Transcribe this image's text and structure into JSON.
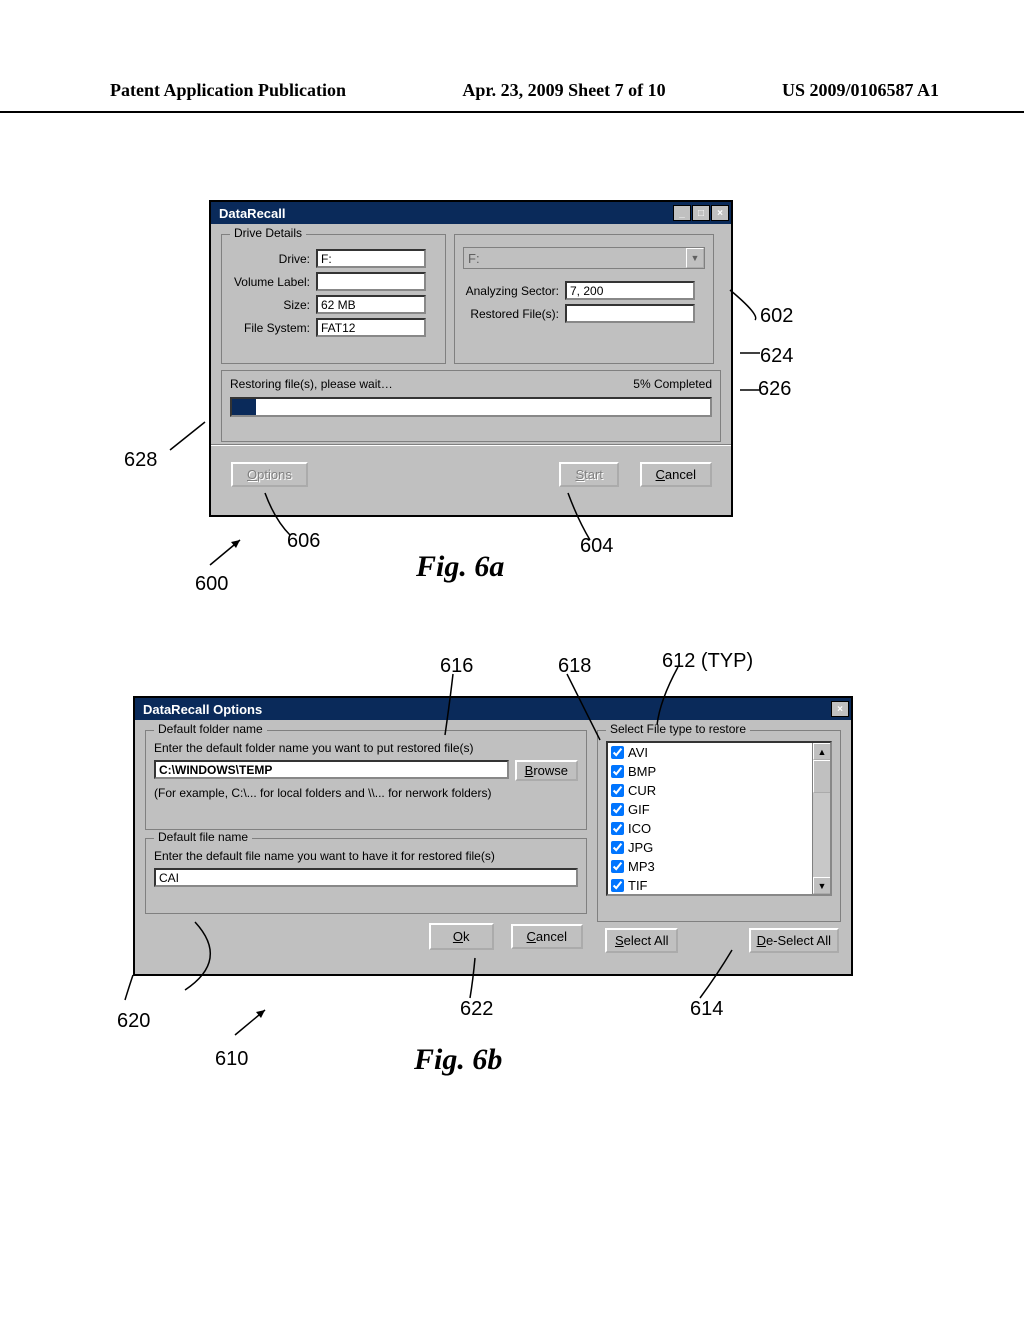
{
  "header": {
    "left": "Patent Application Publication",
    "mid": "Apr. 23, 2009  Sheet 7 of 10",
    "right": "US 2009/0106587 A1"
  },
  "win1": {
    "title": "DataRecall",
    "group_drive": "Drive Details",
    "lbl_drive": "Drive:",
    "val_drive": "F:",
    "lbl_vol": "Volume Label:",
    "val_vol": "",
    "lbl_size": "Size:",
    "val_size": "62 MB",
    "lbl_fs": "File System:",
    "val_fs": "FAT12",
    "dropdown_sel": "F:",
    "lbl_analyzing": "Analyzing Sector:",
    "val_analyzing": "7, 200",
    "lbl_restored": "Restored File(s):",
    "val_restored": "",
    "restoring_msg": "Restoring file(s), please wait…",
    "pct": "5% Completed",
    "progress_pct": 5,
    "btn_options": "Options",
    "btn_options_ul": "O",
    "btn_start": "Start",
    "btn_start_ul": "S",
    "btn_cancel": "Cancel",
    "btn_cancel_ul": "C"
  },
  "callouts1": {
    "c602": "602",
    "c624": "624",
    "c626": "626",
    "c628": "628",
    "c606": "606",
    "c604": "604",
    "c600": "600"
  },
  "caption1": "Fig. 6a",
  "win2": {
    "title": "DataRecall Options",
    "group_folder": "Default folder name",
    "folder_prompt": "Enter the default folder name you want to put restored file(s)",
    "folder_value": "C:\\WINDOWS\\TEMP",
    "folder_hint": "(For example, C:\\... for local folders and \\\\... for nerwork folders)",
    "btn_browse": "Browse",
    "btn_browse_ul": "B",
    "group_file": "Default file name",
    "file_prompt": "Enter the default file name you want to have it for restored file(s)",
    "file_value": "CAI",
    "group_types": "Select File type to restore",
    "types": [
      "AVI",
      "BMP",
      "CUR",
      "GIF",
      "ICO",
      "JPG",
      "MP3",
      "TIF"
    ],
    "btn_ok": "Ok",
    "btn_ok_ul": "O",
    "btn_cancel": "Cancel",
    "btn_cancel_ul": "C",
    "btn_selectall": "Select All",
    "btn_selectall_ul": "S",
    "btn_deselectall": "De-Select All",
    "btn_deselectall_ul": "D"
  },
  "callouts2": {
    "c616": "616",
    "c618": "618",
    "c612": "612 (TYP)",
    "c620": "620",
    "c622": "622",
    "c614": "614",
    "c610": "610"
  },
  "caption2": "Fig. 6b"
}
